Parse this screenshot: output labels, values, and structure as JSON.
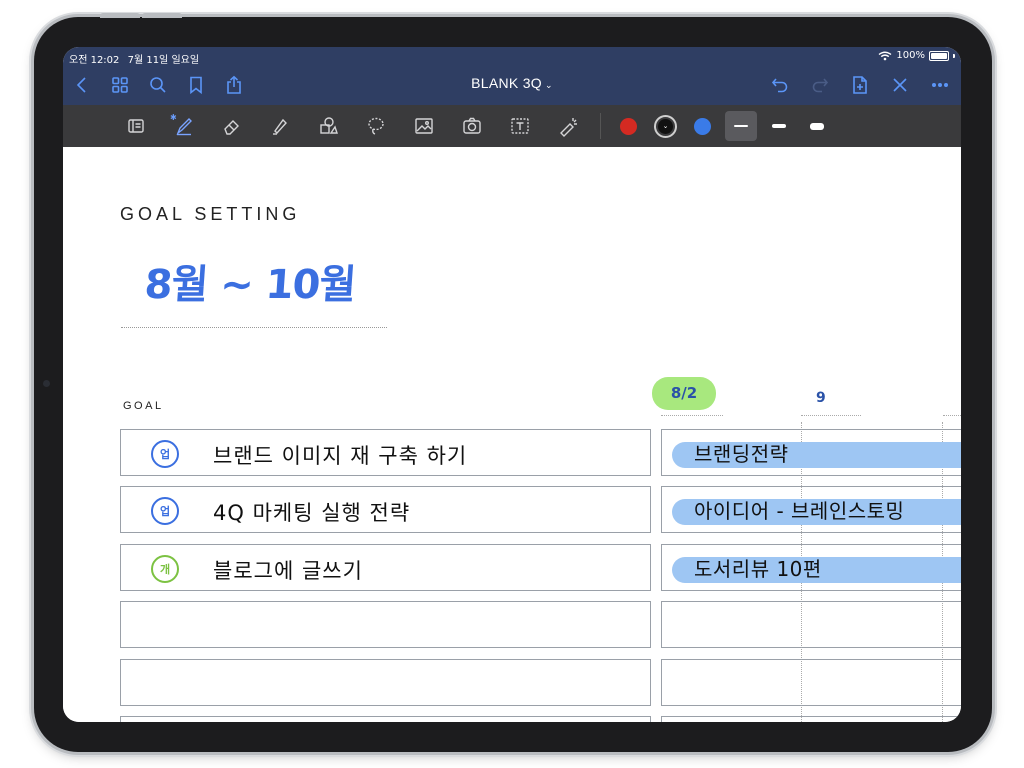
{
  "status": {
    "time": "오전 12:02",
    "date": "7월 11일 일요일",
    "battery": "100%"
  },
  "nav": {
    "title": "BLANK 3Q",
    "title_chevron": "⌄"
  },
  "toolbar": {
    "bluetooth": "✱",
    "colors": {
      "red": "#d42a22",
      "black": "#111111",
      "blue": "#3a7be8"
    },
    "black_swatch_glyph": "⌄"
  },
  "page": {
    "heading": "GOAL SETTING",
    "period": "8월 ~ 10월",
    "goal_label": "GOAL",
    "dates": [
      "8/2",
      "9"
    ],
    "rows": [
      {
        "icon": "업",
        "icon_color": "#3b6fe0",
        "text": "브랜드 이미지 재 구축 하기",
        "plan": "브랜딩전략"
      },
      {
        "icon": "업",
        "icon_color": "#3b6fe0",
        "text": "4Q 마케팅 실행 전략",
        "plan": "아이디어 - 브레인스토밍"
      },
      {
        "icon": "개",
        "icon_color": "#7cc242",
        "text": "블로그에 글쓰기",
        "plan": "도서리뷰 10편"
      },
      {
        "icon": "",
        "icon_color": "",
        "text": "",
        "plan": ""
      },
      {
        "icon": "",
        "icon_color": "",
        "text": "",
        "plan": ""
      },
      {
        "icon": "",
        "icon_color": "",
        "text": "",
        "plan": ""
      }
    ]
  }
}
